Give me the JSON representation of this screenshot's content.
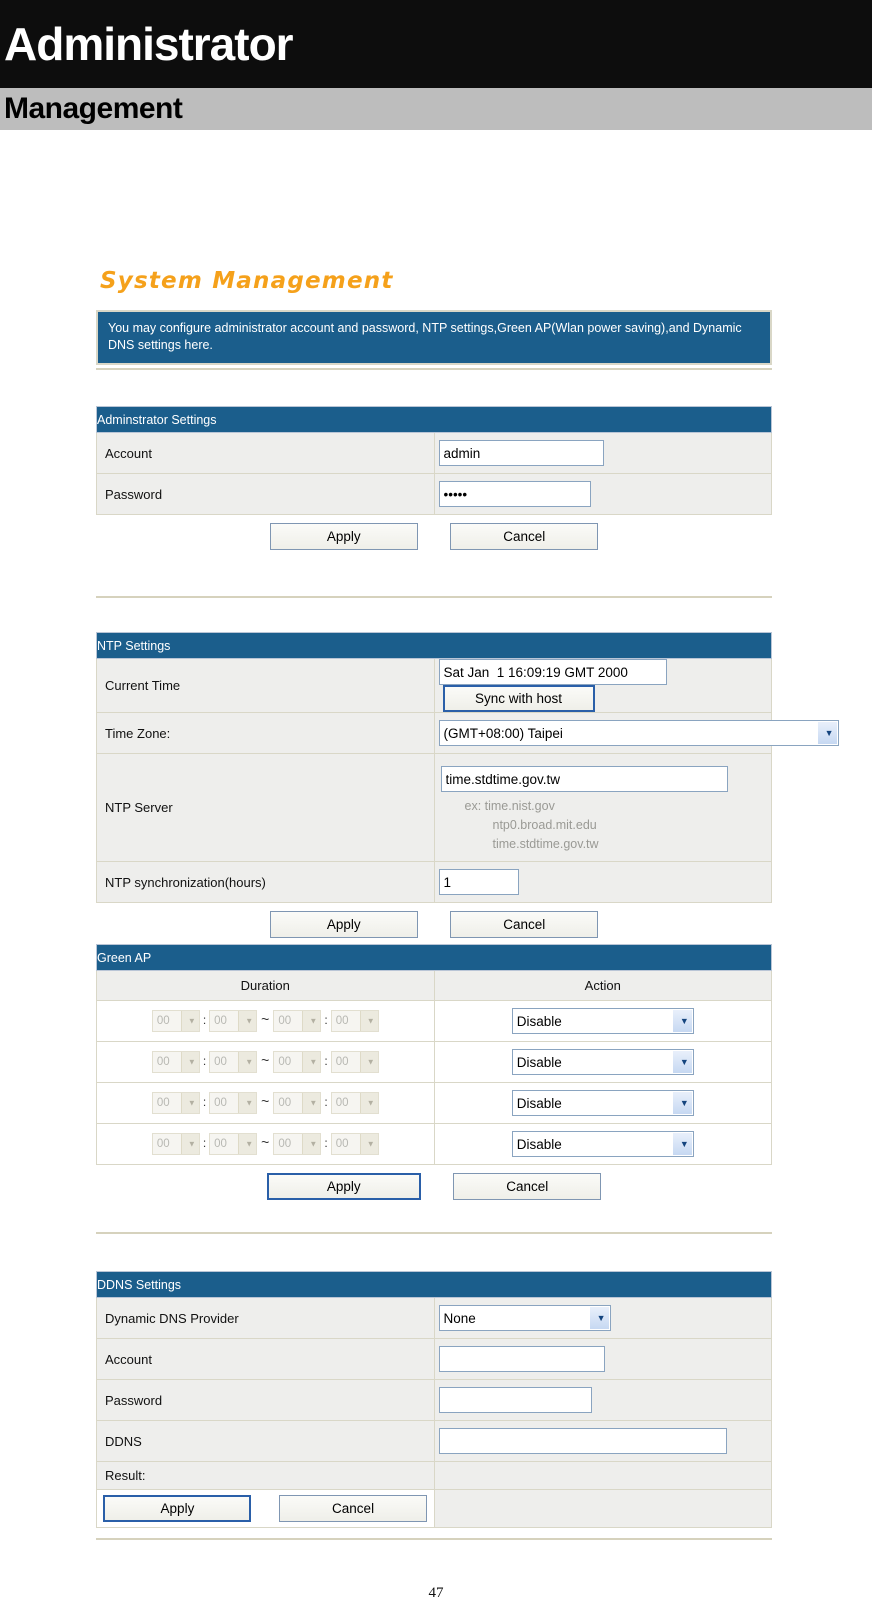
{
  "banner": {
    "title": "Administrator",
    "subtitle": "Management"
  },
  "page_title": "System Management",
  "description": "You may configure administrator account and password, NTP settings,Green AP(Wlan power saving),and Dynamic DNS settings here.",
  "buttons": {
    "apply": "Apply",
    "cancel": "Cancel",
    "sync_with_host": "Sync with host"
  },
  "admin_settings": {
    "heading": "Adminstrator Settings",
    "rows": [
      {
        "label": "Account",
        "value": "admin"
      },
      {
        "label": "Password",
        "value": "•••••"
      }
    ]
  },
  "ntp_settings": {
    "heading": "NTP Settings",
    "current_time_label": "Current Time",
    "current_time_value": "Sat Jan  1 16:09:19 GMT 2000",
    "time_zone_label": "Time Zone:",
    "time_zone_value": "(GMT+08:00) Taipei",
    "ntp_server_label": "NTP Server",
    "ntp_server_value": "time.stdtime.gov.tw",
    "ntp_server_examples": [
      "ex: time.nist.gov",
      "ntp0.broad.mit.edu",
      "time.stdtime.gov.tw"
    ],
    "sync_hours_label": "NTP synchronization(hours)",
    "sync_hours_value": "1"
  },
  "green_ap": {
    "heading": "Green AP",
    "col_duration": "Duration",
    "col_action": "Action",
    "time_value": "00",
    "colon": ":",
    "tilde": "~",
    "rows": [
      {
        "start_hour": "00",
        "start_min": "00",
        "end_hour": "00",
        "end_min": "00",
        "action": "Disable"
      },
      {
        "start_hour": "00",
        "start_min": "00",
        "end_hour": "00",
        "end_min": "00",
        "action": "Disable"
      },
      {
        "start_hour": "00",
        "start_min": "00",
        "end_hour": "00",
        "end_min": "00",
        "action": "Disable"
      },
      {
        "start_hour": "00",
        "start_min": "00",
        "end_hour": "00",
        "end_min": "00",
        "action": "Disable"
      }
    ]
  },
  "ddns_settings": {
    "heading": "DDNS Settings",
    "provider_label": "Dynamic DNS Provider",
    "provider_value": "None",
    "account_label": "Account",
    "account_value": "",
    "password_label": "Password",
    "password_value": "",
    "ddns_label": "DDNS",
    "ddns_value": "",
    "result_label": "Result:",
    "result_value": ""
  },
  "footer": {
    "page_number": "47"
  },
  "colors": {
    "banner_black": "#0d0d0d",
    "banner_grey": "#bdbdbd",
    "accent_orange": "#F5A11B",
    "section_blue": "#1b5e8c",
    "row_grey": "#eeeeec",
    "border_tan": "#d9d7c7"
  }
}
